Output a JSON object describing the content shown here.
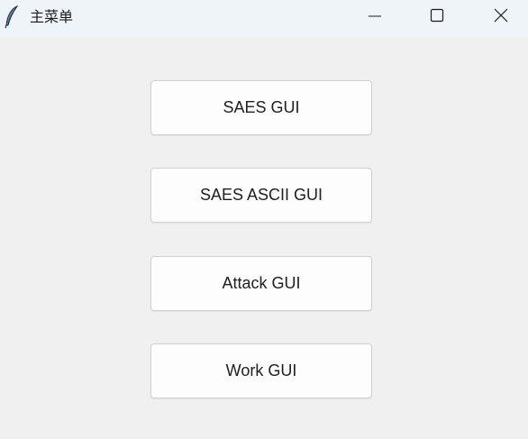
{
  "window": {
    "title": "主菜单",
    "icon": "feather-icon",
    "controls": [
      "minimize-icon",
      "maximize-icon",
      "close-icon"
    ]
  },
  "menu": {
    "buttons": [
      {
        "label": "SAES GUI"
      },
      {
        "label": "SAES ASCII GUI"
      },
      {
        "label": "Attack GUI"
      },
      {
        "label": "Work GUI"
      }
    ]
  },
  "colors": {
    "titlebar_bg": "#eff4f9",
    "window_bg": "#f0f0f0",
    "button_bg": "#fdfdfd",
    "button_border": "#d0d0d0"
  }
}
